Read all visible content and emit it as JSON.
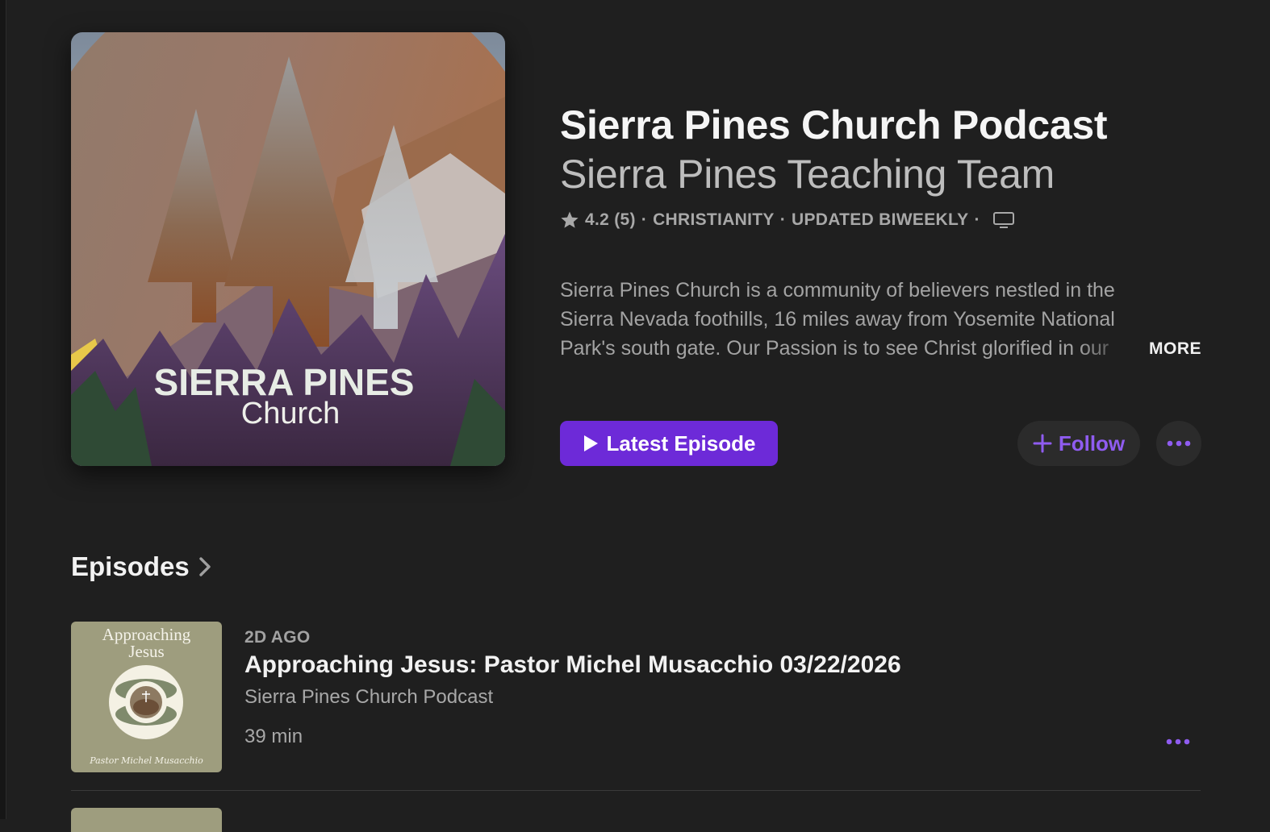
{
  "podcast": {
    "title": "Sierra Pines Church Podcast",
    "author": "Sierra Pines Teaching Team",
    "rating": "4.2 (5)",
    "category": "CHRISTIANITY",
    "frequency": "UPDATED BIWEEKLY",
    "separator": "·",
    "description": "Sierra Pines Church is a community of believers nestled in the Sierra Nevada foothills, 16 miles away from Yosemite National Park's south gate. Our Passion is to see Christ glorified in our",
    "more_label": "MORE",
    "artwork_text": {
      "line1": "SIERRA PINES",
      "line2": "Church"
    }
  },
  "actions": {
    "latest_episode_label": "Latest Episode",
    "follow_label": "Follow"
  },
  "episodes": {
    "heading": "Episodes",
    "items": [
      {
        "date": "2D AGO",
        "title": "Approaching Jesus: Pastor Michel Musacchio 03/22/2026",
        "show": "Sierra Pines Church Podcast",
        "duration": "39 min",
        "artwork_title_line1": "Approaching",
        "artwork_title_line2": "Jesus",
        "artwork_signature": "Pastor Michel Musacchio"
      }
    ]
  },
  "colors": {
    "background": "#1f1f1f",
    "accent": "#6d2ad8",
    "accent_text": "#8f5cf0"
  },
  "icons": [
    "star-icon",
    "monitor-icon",
    "play-icon",
    "plus-icon",
    "ellipsis-icon",
    "chevron-right-icon"
  ]
}
